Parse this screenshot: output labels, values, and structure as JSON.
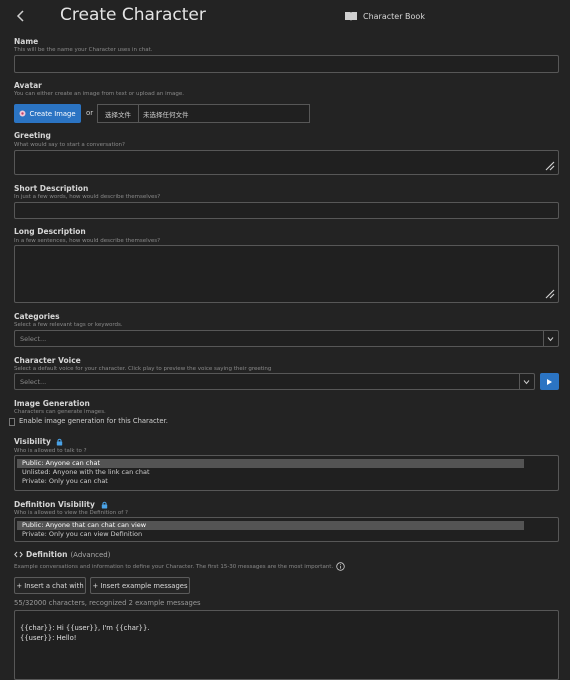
{
  "header": {
    "back_icon": "chevron-left-icon",
    "title": "Create Character",
    "book_icon": "book-icon",
    "book_label": "Character Book"
  },
  "name": {
    "label": "Name",
    "hint": "This will be the name your Character uses in chat.",
    "value": ""
  },
  "avatar": {
    "label": "Avatar",
    "hint": "You can either create an image from text or upload an image.",
    "create_label": "Create Image",
    "or_label": "or",
    "choose_file_label": "选择文件",
    "no_file_label": "未选择任何文件"
  },
  "greeting": {
    "label": "Greeting",
    "hint": "What would say to start a conversation?",
    "value": ""
  },
  "short_description": {
    "label": "Short Description",
    "hint": "In just a few words, how would describe themselves?",
    "value": ""
  },
  "long_description": {
    "label": "Long Description",
    "hint": "In a few sentences, how would describe themselves?",
    "value": ""
  },
  "categories": {
    "label": "Categories",
    "hint": "Select a few relevant tags or keywords.",
    "placeholder": "Select..."
  },
  "voice": {
    "label": "Character Voice",
    "hint": "Select a default voice for your character. Click play to preview the voice saying their greeting",
    "placeholder": "Select..."
  },
  "image_generation": {
    "label": "Image Generation",
    "hint": "Characters can generate images.",
    "checkbox_label": "Enable image generation for this Character.",
    "checked": false
  },
  "visibility": {
    "label": "Visibility",
    "hint": "Who is allowed to talk to ?",
    "options": [
      "Public: Anyone can chat",
      "Unlisted: Anyone with the link can chat",
      "Private: Only you can chat"
    ],
    "selected_index": 0
  },
  "definition_visibility": {
    "label": "Definition Visibility",
    "hint": "Who is allowed to view the Definition of ?",
    "options": [
      "Public: Anyone that can chat can view",
      "Private: Only you can view Definition"
    ],
    "selected_index": 0
  },
  "definition": {
    "label": "Definition",
    "advanced_label": "(Advanced)",
    "hint": "Example conversations and information to define your Character. The first 15-30 messages are the most important.",
    "insert_chat_label": "+ Insert a chat with",
    "insert_examples_label": "+ Insert example messages",
    "counter": "55/32000 characters, recognized 2 example messages",
    "lines": [
      "{{char}}: Hi {{user}}, I'm {{char}}.",
      "{{user}}: Hello!"
    ]
  },
  "colors": {
    "accent": "#2b74c3",
    "background": "#232323"
  }
}
